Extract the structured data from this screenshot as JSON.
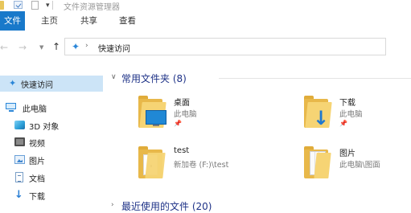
{
  "window": {
    "title": "文件资源管理器",
    "quick_access_toolbar": [
      "folder-icon",
      "properties-check-icon",
      "new-folder-icon",
      "customize-dropdown-icon"
    ]
  },
  "ribbon": {
    "tabs": [
      {
        "label": "文件",
        "active": true
      },
      {
        "label": "主页"
      },
      {
        "label": "共享"
      },
      {
        "label": "查看"
      }
    ]
  },
  "address_bar": {
    "icon": "quick-access-pin-icon",
    "separator": "›",
    "path": "快速访问"
  },
  "nav_pane": {
    "items": [
      {
        "label": "快速访问",
        "icon": "pin-icon",
        "selected": true
      },
      {
        "label": "此电脑",
        "icon": "computer-icon"
      },
      {
        "label": "3D 对象",
        "icon": "3d-objects-icon"
      },
      {
        "label": "视频",
        "icon": "video-icon"
      },
      {
        "label": "图片",
        "icon": "pictures-icon"
      },
      {
        "label": "文档",
        "icon": "documents-icon"
      },
      {
        "label": "下载",
        "icon": "download-icon"
      }
    ]
  },
  "content": {
    "frequent_folders_header": "常用文件夹 (8)",
    "recent_files_header": "最近使用的文件 (20)",
    "folders": [
      {
        "name": "桌面",
        "location": "此电脑",
        "pinned": true,
        "icon": "desktop-folder-icon"
      },
      {
        "name": "下载",
        "location": "此电脑",
        "pinned": true,
        "icon": "downloads-folder-icon"
      },
      {
        "name": "test",
        "location": "新加卷 (F:)\\test",
        "pinned": false,
        "icon": "folder-icon"
      },
      {
        "name": "图片",
        "location": "此电脑\\图面",
        "pinned": false,
        "icon": "pictures-folder-icon"
      }
    ]
  },
  "colors": {
    "file_tab": "#1979ca",
    "selection": "#cce4f7",
    "group_header": "#1e3287",
    "folder": "#f6d474"
  }
}
